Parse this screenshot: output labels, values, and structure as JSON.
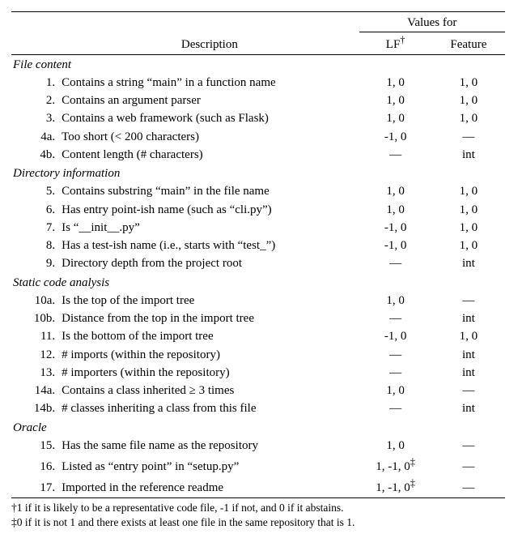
{
  "header": {
    "values_for": "Values for",
    "description": "Description",
    "lf": "LF",
    "lf_dagger": "†",
    "feature": "Feature"
  },
  "sections": [
    {
      "label": "File content",
      "rows": [
        {
          "num": "1.",
          "desc": "Contains a string “main” in a function name",
          "lf": "1, 0",
          "feat": "1, 0"
        },
        {
          "num": "2.",
          "desc": "Contains an argument parser",
          "lf": "1, 0",
          "feat": "1, 0"
        },
        {
          "num": "3.",
          "desc": "Contains a web framework (such as Flask)",
          "lf": "1, 0",
          "feat": "1, 0"
        },
        {
          "num": "4a.",
          "desc": "Too short (< 200 characters)",
          "lf": "-1, 0",
          "feat": "—"
        },
        {
          "num": "4b.",
          "desc": "Content length (# characters)",
          "lf": "—",
          "feat": "int"
        }
      ]
    },
    {
      "label": "Directory information",
      "rows": [
        {
          "num": "5.",
          "desc": "Contains substring “main” in the file name",
          "lf": "1, 0",
          "feat": "1, 0"
        },
        {
          "num": "6.",
          "desc": "Has entry point-ish name (such as “cli.py”)",
          "lf": "1, 0",
          "feat": "1, 0"
        },
        {
          "num": "7.",
          "desc": "Is “__init__.py”",
          "lf": "-1, 0",
          "feat": "1, 0"
        },
        {
          "num": "8.",
          "desc": "Has a test-ish name (i.e., starts with “test_”)",
          "lf": "-1, 0",
          "feat": "1, 0"
        },
        {
          "num": "9.",
          "desc": "Directory depth from the project root",
          "lf": "—",
          "feat": "int"
        }
      ]
    },
    {
      "label": "Static code analysis",
      "rows": [
        {
          "num": "10a.",
          "desc": "Is the top of the import tree",
          "lf": "1, 0",
          "feat": "—"
        },
        {
          "num": "10b.",
          "desc": "Distance from the top in the import tree",
          "lf": "—",
          "feat": "int"
        },
        {
          "num": "11.",
          "desc": "Is the bottom of the import tree",
          "lf": "-1, 0",
          "feat": "1, 0"
        },
        {
          "num": "12.",
          "desc": "# imports (within the repository)",
          "lf": "—",
          "feat": "int"
        },
        {
          "num": "13.",
          "desc": "# importers (within the repository)",
          "lf": "—",
          "feat": "int"
        },
        {
          "num": "14a.",
          "desc": "Contains a class inherited ≥ 3 times",
          "lf": "1, 0",
          "feat": "—"
        },
        {
          "num": "14b.",
          "desc": "# classes inheriting a class from this file",
          "lf": "—",
          "feat": "int"
        }
      ]
    },
    {
      "label": "Oracle",
      "rows": [
        {
          "num": "15.",
          "desc": "Has the same file name as the repository",
          "lf": "1, 0",
          "feat": "—"
        },
        {
          "num": "16.",
          "desc": "Listed as “entry point” in “setup.py”",
          "lf": "1, -1, 0",
          "lf_sup": "‡",
          "feat": "—"
        },
        {
          "num": "17.",
          "desc": "Imported in the reference readme",
          "lf": "1, -1, 0",
          "lf_sup": "‡",
          "feat": "—"
        }
      ]
    }
  ],
  "footnotes": {
    "dagger": "†1 if it is likely to be a representative code file, -1 if not, and 0 if it abstains.",
    "ddagger": "‡0 if it is not 1 and there exists at least one file in the same repository that is 1."
  }
}
